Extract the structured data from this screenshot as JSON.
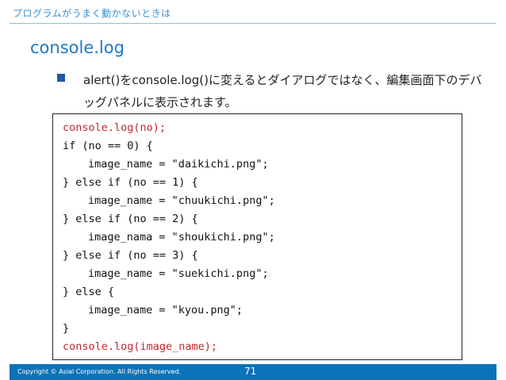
{
  "header": {
    "section_title": "プログラムがうまく動かないときは"
  },
  "title": "console.log",
  "bullet": {
    "text": "alert()をconsole.log()に変えるとダイアログではなく、編集画面下のデバッグパネルに表示されます。"
  },
  "code": {
    "lines": [
      "console.log(no);",
      "if (no == 0) {",
      "image_name = \"daikichi.png\";",
      "} else if (no == 1) {",
      "image_name = \"chuukichi.png\";",
      "} else if (no == 2) {",
      "image_nama = \"shoukichi.png\";",
      "} else if (no == 3) {",
      "image_name = \"suekichi.png\";",
      "} else {",
      "image_name = \"kyou.png\";",
      "}",
      "console.log(image_name);"
    ]
  },
  "footer": {
    "copyright": "Copyright © Asial Corporation. All Rights Reserved.",
    "page_number": "71"
  },
  "colors": {
    "accent": "#1e78c8",
    "footer_bg": "#0b73b7",
    "highlight_code": "#c0282d"
  }
}
